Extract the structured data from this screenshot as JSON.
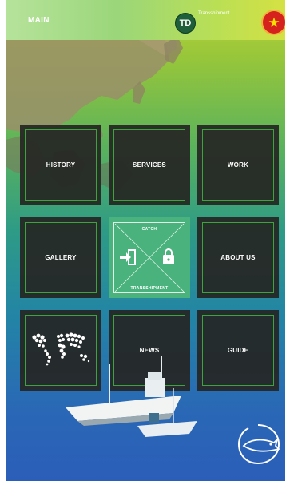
{
  "header": {
    "title": "MAIN",
    "logo_text": "TD",
    "logo_caption": "Transshipment"
  },
  "menu": {
    "history": "HISTORY",
    "services": "SERVICES",
    "work": "WORK",
    "gallery": "GALLERY",
    "center_top": "CATCH",
    "center_bottom": "TRANSSHIPMENT",
    "about": "ABOUT US",
    "news": "NEWS",
    "guide": "GUIDE"
  },
  "colors": {
    "tile_border": "#3ea23e",
    "center_tile": "#4ab27d",
    "flag_red": "#d6221d",
    "flag_star": "#ffde00"
  },
  "icons": [
    "flag-icon",
    "enter-icon",
    "lock-icon",
    "world-map-icon",
    "brand-badge-icon"
  ]
}
